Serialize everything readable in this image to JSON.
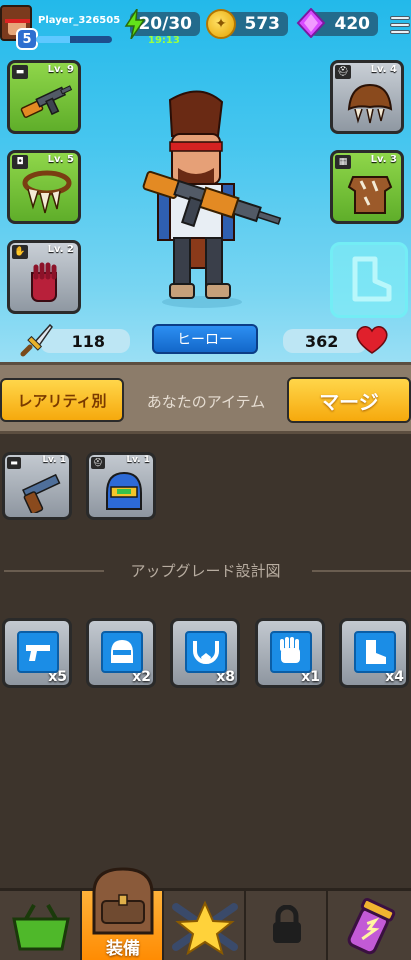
{
  "player": {
    "name": "Player_326505",
    "level": "5",
    "xp_fraction": 0.45
  },
  "resources": {
    "energy": "20/30",
    "energy_timer": "19:13",
    "coins": "573",
    "gems": "420"
  },
  "equipped": {
    "weapon": {
      "level": "Lv. 9"
    },
    "necklace": {
      "level": "Lv. 5"
    },
    "gloves": {
      "level": "Lv. 2"
    },
    "helmet": {
      "level": "Lv. 4"
    },
    "armor": {
      "level": "Lv. 3"
    }
  },
  "stats": {
    "attack": "118",
    "health": "362"
  },
  "hero_button": "ヒーロー",
  "filters": {
    "rarity": "レアリティ別",
    "your_items": "あなたのアイテム",
    "merge": "マージ"
  },
  "inventory": [
    {
      "level": "Lv. 1"
    },
    {
      "level": "Lv. 1"
    }
  ],
  "upgrade_title": "アップグレード設計図",
  "blueprints": [
    {
      "type": "weapon",
      "count": "x5"
    },
    {
      "type": "helmet",
      "count": "x2"
    },
    {
      "type": "necklace",
      "count": "x8"
    },
    {
      "type": "gloves",
      "count": "x1"
    },
    {
      "type": "boots",
      "count": "x4"
    }
  ],
  "nav": {
    "equipment_label": "装備"
  },
  "colors": {
    "rare_green": "#6cbe33",
    "common_gray": "#a8b0b9",
    "accent_yellow": "#f8b81a",
    "blueprint_blue": "#1b8de6"
  }
}
